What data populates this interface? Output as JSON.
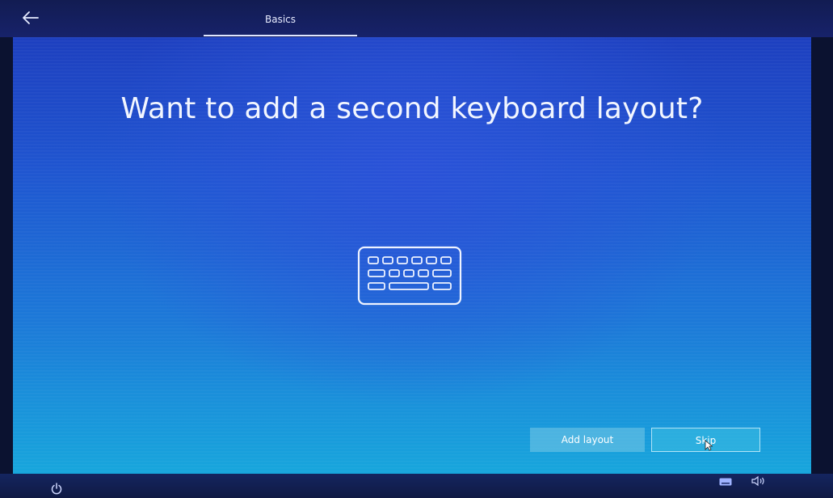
{
  "header": {
    "back_icon": "back-arrow-icon",
    "tab_label": "Basics"
  },
  "main": {
    "title": "Want to add a second keyboard layout?",
    "illustration_icon": "keyboard-icon"
  },
  "actions": {
    "add_layout_label": "Add layout",
    "skip_label": "Skip"
  },
  "footer": {
    "left_icon": "power-icon",
    "right_icons": [
      "keyboard-icon",
      "volume-icon"
    ]
  },
  "colors": {
    "top_bar": "#17226a",
    "screen_top": "#1d3fbf",
    "screen_bottom": "#17a6dc",
    "text": "#f2f6ff"
  }
}
